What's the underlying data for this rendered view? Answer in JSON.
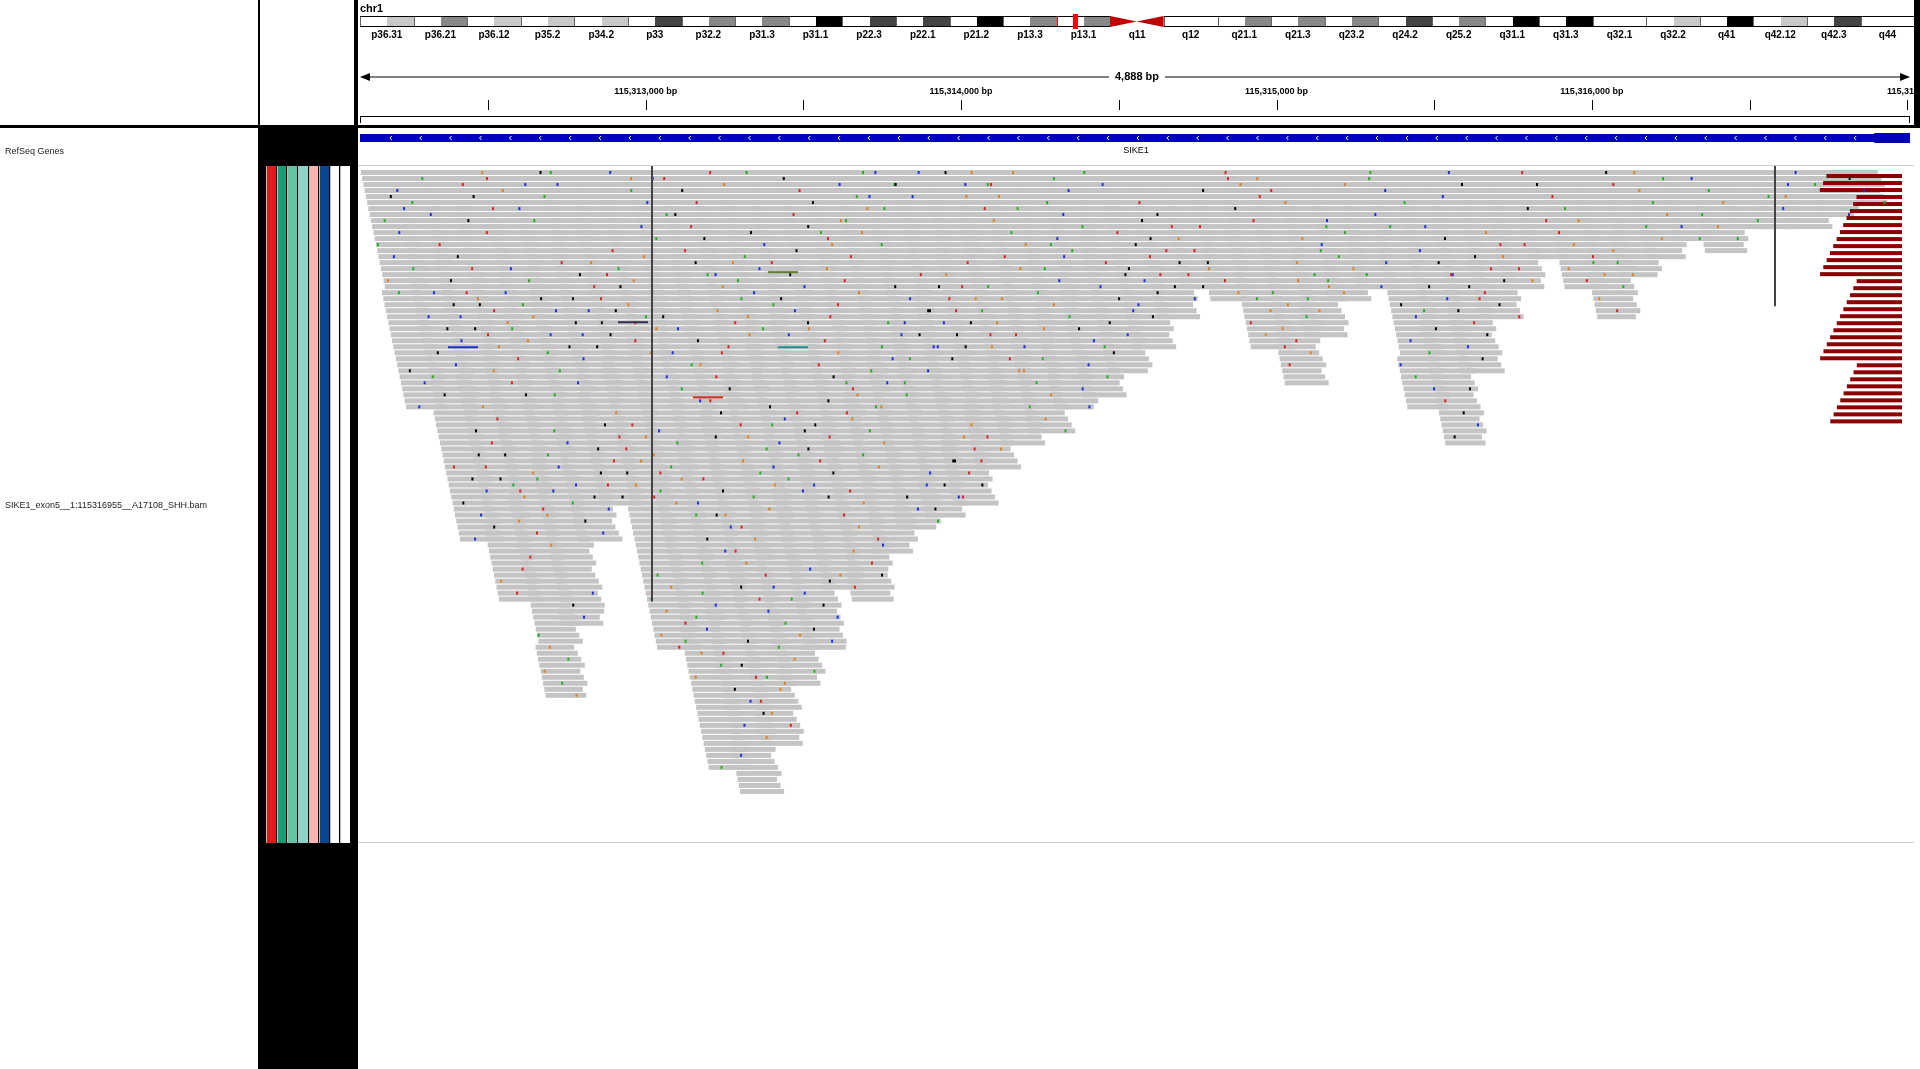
{
  "chromosome": {
    "name": "chr1",
    "bands": [
      {
        "label": "p36.31",
        "kind": "band",
        "color": "#c8c8c8"
      },
      {
        "label": "p36.21",
        "kind": "band",
        "color": "#888888"
      },
      {
        "label": "p36.12",
        "kind": "band",
        "color": "#c8c8c8"
      },
      {
        "label": "p35.2",
        "kind": "band",
        "color": "#c8c8c8"
      },
      {
        "label": "p34.2",
        "kind": "band",
        "color": "#c8c8c8"
      },
      {
        "label": "p33",
        "kind": "band",
        "color": "#444444"
      },
      {
        "label": "p32.2",
        "kind": "band",
        "color": "#888888"
      },
      {
        "label": "p31.3",
        "kind": "band",
        "color": "#888888"
      },
      {
        "label": "p31.1",
        "kind": "band",
        "color": "#000000"
      },
      {
        "label": "p22.3",
        "kind": "band",
        "color": "#444444"
      },
      {
        "label": "p22.1",
        "kind": "band",
        "color": "#444444"
      },
      {
        "label": "p21.2",
        "kind": "band",
        "color": "#000000"
      },
      {
        "label": "p13.3",
        "kind": "band",
        "color": "#888888"
      },
      {
        "label": "p13.1",
        "kind": "band",
        "color": "#888888",
        "current": true
      },
      {
        "label": "q11",
        "kind": "centromere",
        "color": "#c00000"
      },
      {
        "label": "q12",
        "kind": "band",
        "color": "#ffffff"
      },
      {
        "label": "q21.1",
        "kind": "band",
        "color": "#888888"
      },
      {
        "label": "q21.3",
        "kind": "band",
        "color": "#888888"
      },
      {
        "label": "q23.2",
        "kind": "band",
        "color": "#888888"
      },
      {
        "label": "q24.2",
        "kind": "band",
        "color": "#444444"
      },
      {
        "label": "q25.2",
        "kind": "band",
        "color": "#888888"
      },
      {
        "label": "q31.1",
        "kind": "band",
        "color": "#000000"
      },
      {
        "label": "q31.3",
        "kind": "band",
        "color": "#000000"
      },
      {
        "label": "q32.1",
        "kind": "band",
        "color": "#ffffff"
      },
      {
        "label": "q32.2",
        "kind": "band",
        "color": "#c8c8c8"
      },
      {
        "label": "q41",
        "kind": "band",
        "color": "#000000"
      },
      {
        "label": "q42.12",
        "kind": "band",
        "color": "#c8c8c8"
      },
      {
        "label": "q42.3",
        "kind": "band",
        "color": "#444444"
      },
      {
        "label": "q44",
        "kind": "band",
        "color": "#ffffff"
      }
    ]
  },
  "ruler": {
    "span": "4,888 bp",
    "ticks": [
      {
        "kind": "minor"
      },
      {
        "kind": "major",
        "label": "115,313,000 bp"
      },
      {
        "kind": "minor"
      },
      {
        "kind": "major",
        "label": "115,314,000 bp"
      },
      {
        "kind": "minor"
      },
      {
        "kind": "major",
        "label": "115,315,000 bp"
      },
      {
        "kind": "minor"
      },
      {
        "kind": "major",
        "label": "115,316,000 bp"
      },
      {
        "kind": "minor"
      },
      {
        "kind": "major",
        "label": "115,31"
      }
    ]
  },
  "tracks": [
    {
      "name": "RefSeq Genes",
      "kind": "gene",
      "gene": "SIKE1"
    },
    {
      "name": "SIKE1_exon5__1:115316955__A17108_SHH.bam",
      "kind": "alignment",
      "attributes": [
        {
          "color": "#e31a1c"
        },
        {
          "color": "#1b9e77"
        },
        {
          "color": "#66c2a5"
        },
        {
          "color": "#8dd3c7"
        },
        {
          "color": "#fbb4ae"
        },
        {
          "color": "#0b4690"
        },
        {
          "color": "#ffffff"
        },
        {
          "color": "#ffffff"
        }
      ]
    }
  ]
}
